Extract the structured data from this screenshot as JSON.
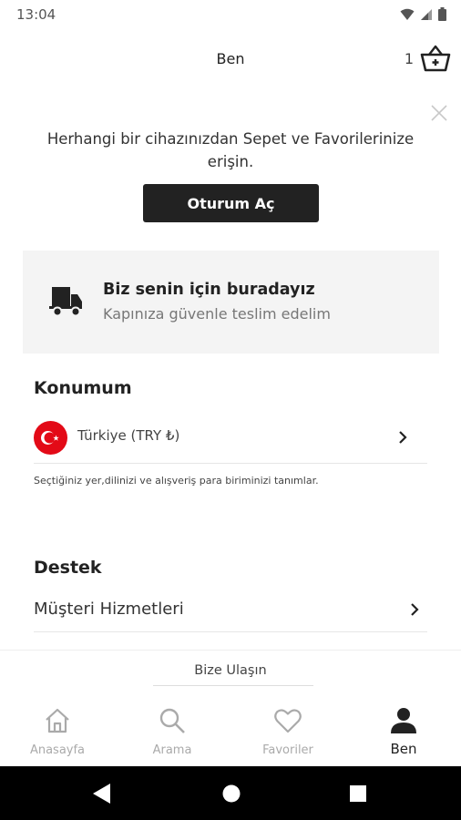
{
  "status_bar": {
    "time": "13:04"
  },
  "header": {
    "title": "Ben",
    "cart_count": "1"
  },
  "signin": {
    "message": "Herhangi bir cihazınızdan Sepet ve Favorilerinize erişin.",
    "button_label": "Oturum Aç"
  },
  "promo": {
    "title": "Biz senin için buradayız",
    "subtitle": "Kapınıza güvenle teslim edelim"
  },
  "location": {
    "section_title": "Konumum",
    "country_label": "Türkiye (TRY ₺)",
    "hint": "Seçtiğiniz yer,dilinizi ve alışveriş para biriminizi tanımlar."
  },
  "support": {
    "section_title": "Destek",
    "customer_service_label": "Müşteri Hizmetleri",
    "contact_label": "Bize Ulaşın"
  },
  "bottom_nav": {
    "items": [
      {
        "label": "Anasayfa",
        "icon": "home-icon",
        "active": false
      },
      {
        "label": "Arama",
        "icon": "search-icon",
        "active": false
      },
      {
        "label": "Favoriler",
        "icon": "heart-icon",
        "active": false
      },
      {
        "label": "Ben",
        "icon": "user-icon",
        "active": true
      }
    ]
  },
  "colors": {
    "primary_button": "#222222",
    "promo_background": "#f4f4f4",
    "flag_red": "#e30a17",
    "inactive_nav": "#aaaaaa"
  }
}
